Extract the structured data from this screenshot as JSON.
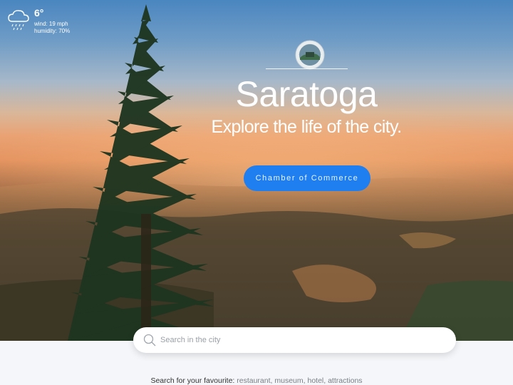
{
  "weather": {
    "icon": "rain-cloud-icon",
    "temperature": "6°",
    "wind": "wind: 19 mph",
    "humidity": "humidity: 70%"
  },
  "hero": {
    "seal_icon": "city-seal-logo",
    "title": "Saratoga",
    "tagline": "Explore the life of the city.",
    "cta_label": "Chamber of Commerce"
  },
  "search": {
    "placeholder": "Search in the city",
    "icon": "search-icon",
    "suggestions_label": "Search for your favourite:",
    "suggestions": [
      "restaurant,",
      "museum,",
      "hotel,",
      "attractions"
    ]
  },
  "colors": {
    "accent": "#1f7ff0",
    "muted_link": "#7a7f86"
  }
}
